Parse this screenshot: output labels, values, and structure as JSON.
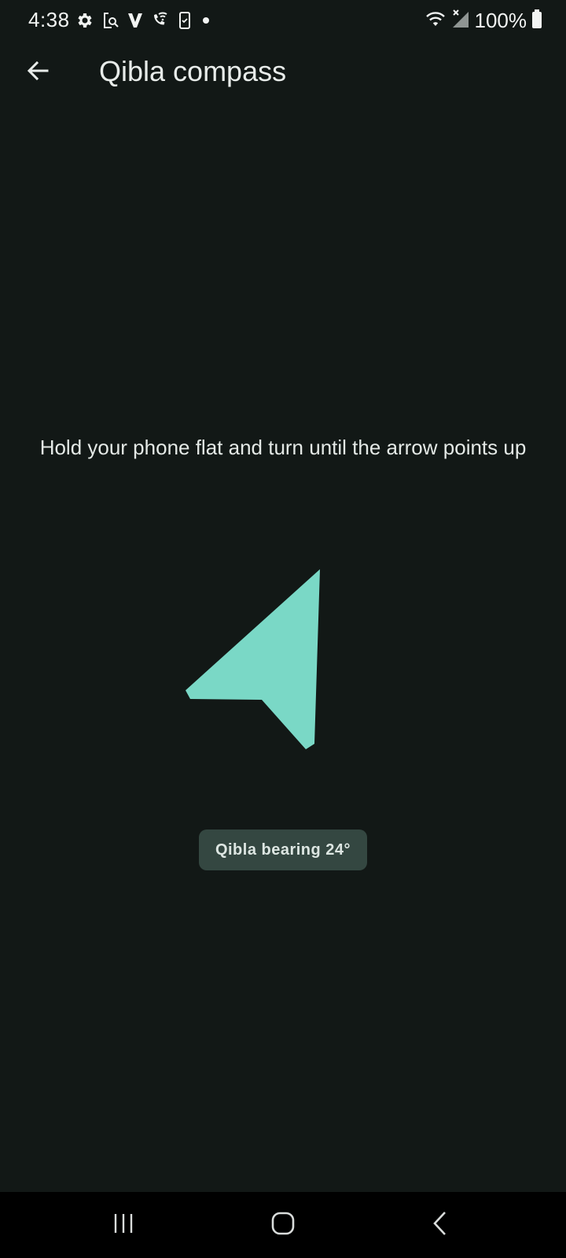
{
  "status_bar": {
    "time": "4:38",
    "battery_percent": "100%",
    "left_icons": [
      "gear-icon",
      "screen-search-icon",
      "v-icon",
      "wifi-call-icon",
      "phone-check-icon",
      "dot-icon"
    ],
    "right_icons": [
      "wifi-icon",
      "signal-no-service-icon",
      "battery-icon"
    ]
  },
  "app_bar": {
    "back_icon": "arrow-left-icon",
    "title": "Qibla compass"
  },
  "main": {
    "instruction": "Hold your phone flat and turn until the arrow points up",
    "arrow_icon": "navigation-arrow-icon",
    "arrow_color": "#7ad8c6",
    "bearing_label": "Qibla bearing 24°"
  },
  "nav_bar": {
    "recents_icon": "recents-icon",
    "home_icon": "home-icon",
    "back_icon": "chevron-left-icon"
  },
  "colors": {
    "background": "#121816",
    "chip_background": "#344741",
    "accent": "#7ad8c6"
  }
}
